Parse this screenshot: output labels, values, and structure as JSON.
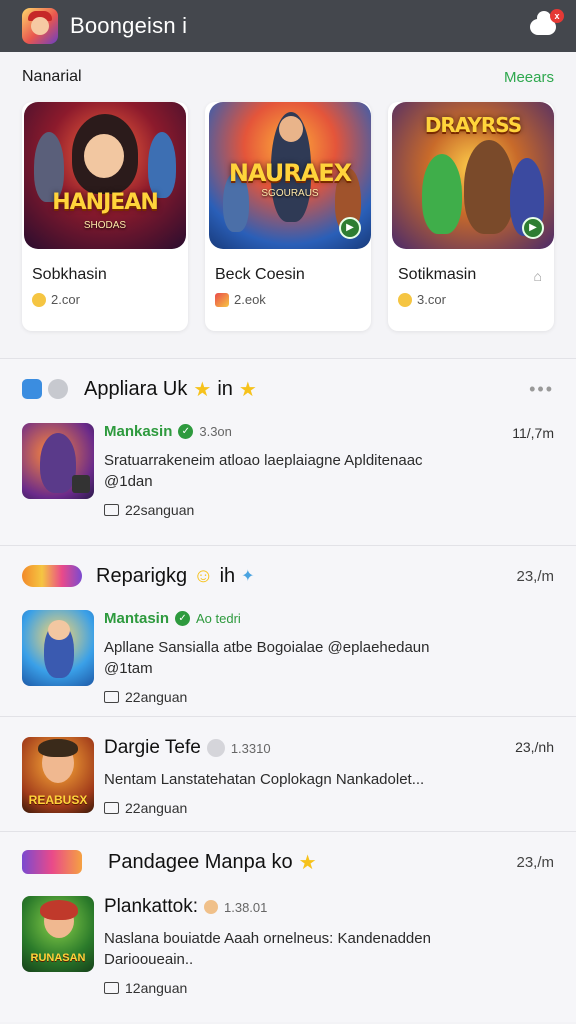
{
  "app": {
    "title": "Boongeisn i",
    "notifications_badge": "x"
  },
  "featured": {
    "title": "Nanarial",
    "more": "Meears",
    "cards": [
      {
        "name": "Sobkhasin",
        "meta": "2.cor",
        "thumb_title": "HANJEAN",
        "thumb_sub": "SHODAS"
      },
      {
        "name": "Beck Coesin",
        "meta": "2.eok",
        "thumb_title": "NAURAEX",
        "thumb_sub": "SGOURAUS"
      },
      {
        "name": "Sotikmasin",
        "meta": "3.cor",
        "thumb_title": "DRAYRSS",
        "thumb_sub": ""
      }
    ]
  },
  "groups": [
    {
      "title": "Appliara Uk",
      "title_suffix": "in",
      "item": {
        "title": "Mankasin",
        "sub": "3.3on",
        "right": "11/,7m",
        "desc": "Sratuarrakeneim atloao laeplaiagne Aplditenaac",
        "desc2": "@1dan",
        "foot": "22sanguan"
      }
    },
    {
      "title": "Reparigkg",
      "title_suffix": "ih",
      "right": "23,/m",
      "item": {
        "title": "Mantasin",
        "sub": "Ao tedri",
        "desc": "Apllane Sansialla atbe Bogoialae @eplaehedaun",
        "desc2": "@1tam",
        "foot": "22anguan"
      }
    },
    {
      "item": {
        "title": "Dargie Tefe",
        "sub": "1.3310",
        "right": "23,/nh",
        "desc": "Nentam Lanstatehatan Coplokagn Nankadolet...",
        "foot": "22anguan",
        "thumb_title": "REABUSX"
      }
    },
    {
      "title": "Pandagee Manpa ko",
      "right": "23,/m",
      "item": {
        "title": "Plankattok:",
        "sub": "1.38.01",
        "desc": "Naslana bouiatde Aaah ornelneus: Kandenadden",
        "desc2": "Dariooueain..",
        "foot": "12anguan",
        "thumb_title": "RUNASAN"
      }
    }
  ]
}
